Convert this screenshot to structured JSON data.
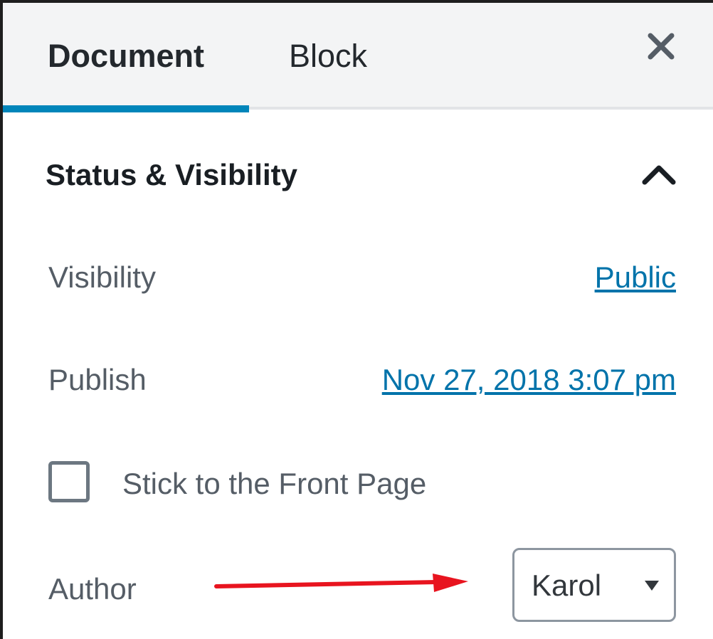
{
  "tabs": {
    "document_label": "Document",
    "block_label": "Block"
  },
  "section": {
    "title": "Status & Visibility",
    "expanded": true
  },
  "visibility": {
    "label": "Visibility",
    "value": "Public"
  },
  "publish": {
    "label": "Publish",
    "value": "Nov 27, 2018 3:07 pm"
  },
  "sticky": {
    "label": "Stick to the Front Page",
    "checked": false
  },
  "author": {
    "label": "Author",
    "selected": "Karol"
  },
  "icons": {
    "close": "close-icon",
    "collapse": "chevron-up-icon",
    "dropdown": "caret-down-icon",
    "annotation": "red-arrow"
  },
  "colors": {
    "accent": "#0085ba",
    "link": "#0073aa",
    "annotation_arrow": "#e8141f",
    "tabbar_bg": "#f3f4f5"
  }
}
